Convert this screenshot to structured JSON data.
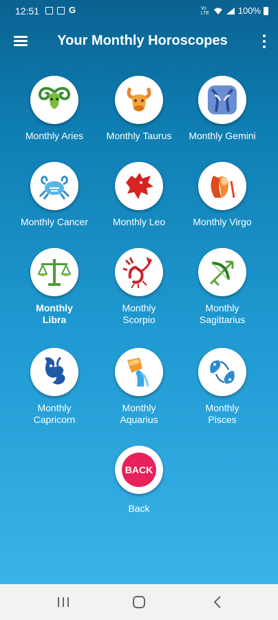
{
  "status_bar": {
    "time": "12:51",
    "battery": "100%"
  },
  "app_bar": {
    "title": "Your Monthly Horoscopes"
  },
  "signs": [
    {
      "label": "Monthly Aries",
      "icon": "aries-icon"
    },
    {
      "label": "Monthly Taurus",
      "icon": "taurus-icon"
    },
    {
      "label": "Monthly Gemini",
      "icon": "gemini-icon"
    },
    {
      "label": "Monthly Cancer",
      "icon": "cancer-icon"
    },
    {
      "label": "Monthly Leo",
      "icon": "leo-icon"
    },
    {
      "label": "Monthly Virgo",
      "icon": "virgo-icon"
    },
    {
      "label": "Monthly\nLibra",
      "icon": "libra-icon"
    },
    {
      "label": "Monthly\nScorpio",
      "icon": "scorpio-icon"
    },
    {
      "label": "Monthly\nSagittarius",
      "icon": "sagittarius-icon"
    },
    {
      "label": "Monthly\nCapricorn",
      "icon": "capricorn-icon"
    },
    {
      "label": "Monthly\nAquarius",
      "icon": "aquarius-icon"
    },
    {
      "label": "Monthly\nPisces",
      "icon": "pisces-icon"
    }
  ],
  "back": {
    "button_text": "BACK",
    "label": "Back"
  },
  "colors": {
    "accent_back": "#e8215a",
    "background_top": "#0a6291",
    "background_bottom": "#3ab3ea"
  }
}
